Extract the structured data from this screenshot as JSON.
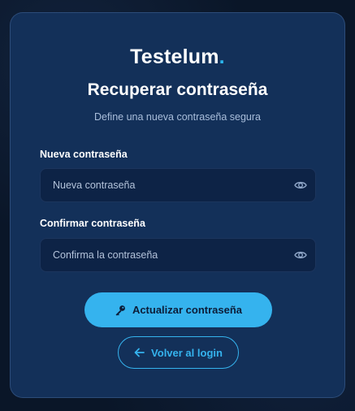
{
  "brand": {
    "name": "Testelum",
    "dot": "."
  },
  "header": {
    "title": "Recuperar contraseña",
    "subtitle": "Define una nueva contraseña segura"
  },
  "form": {
    "new_password": {
      "label": "Nueva contraseña",
      "placeholder": "Nueva contraseña",
      "value": "",
      "toggle_icon": "eye-icon"
    },
    "confirm_password": {
      "label": "Confirmar contraseña",
      "placeholder": "Confirma la contraseña",
      "value": "",
      "toggle_icon": "eye-icon"
    }
  },
  "actions": {
    "submit": {
      "label": "Actualizar contraseña",
      "icon": "key-icon"
    },
    "back": {
      "label": "Volver al login",
      "icon": "arrow-left-icon"
    }
  },
  "colors": {
    "background": "#0a1628",
    "card": "#133059",
    "accent": "#35b3ee",
    "input_bg": "#0d2346"
  }
}
